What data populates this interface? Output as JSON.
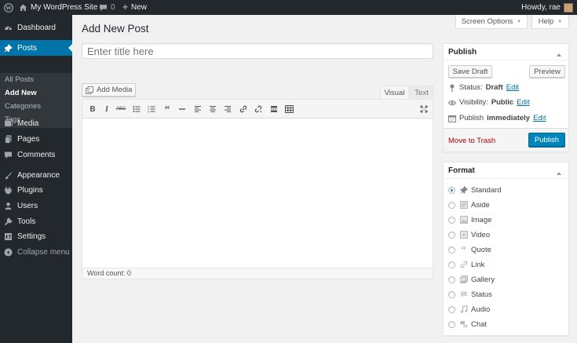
{
  "admin_bar": {
    "site_name": "My WordPress Site",
    "comments_count": "0",
    "new_label": "New",
    "greeting": "Howdy, rae"
  },
  "sidebar": {
    "items": [
      {
        "label": "Dashboard",
        "icon": "dashboard-icon"
      },
      {
        "label": "Posts",
        "icon": "pin-icon",
        "current": true
      },
      {
        "label": "Media",
        "icon": "media-icon"
      },
      {
        "label": "Pages",
        "icon": "pages-icon"
      },
      {
        "label": "Comments",
        "icon": "comment-icon"
      },
      {
        "label": "Appearance",
        "icon": "brush-icon"
      },
      {
        "label": "Plugins",
        "icon": "plugin-icon"
      },
      {
        "label": "Users",
        "icon": "user-icon"
      },
      {
        "label": "Tools",
        "icon": "wrench-icon"
      },
      {
        "label": "Settings",
        "icon": "settings-icon"
      },
      {
        "label": "Collapse menu",
        "icon": "collapse-icon"
      }
    ],
    "submenu": [
      {
        "label": "All Posts"
      },
      {
        "label": "Add New",
        "current": true
      },
      {
        "label": "Categories"
      },
      {
        "label": "Tags"
      }
    ]
  },
  "header": {
    "screen_options": "Screen Options",
    "help": "Help",
    "page_title": "Add New Post"
  },
  "editor": {
    "title_placeholder": "Enter title here",
    "title_value": "",
    "add_media": "Add Media",
    "tab_visual": "Visual",
    "tab_text": "Text",
    "word_count": "Word count: 0",
    "toolbar_buttons": [
      "bold",
      "italic",
      "strikethrough",
      "bulleted-list",
      "numbered-list",
      "blockquote",
      "horizontal-line",
      "align-left",
      "align-center",
      "align-right",
      "insert-link",
      "remove-link",
      "read-more",
      "toolbar-toggle",
      "fullscreen"
    ]
  },
  "publish": {
    "title": "Publish",
    "save_draft": "Save Draft",
    "preview": "Preview",
    "status_label": "Status:",
    "status_value": "Draft",
    "visibility_label": "Visibility:",
    "visibility_value": "Public",
    "schedule_label": "Publish",
    "schedule_value": "immediately",
    "edit_label": "Edit",
    "trash": "Move to Trash",
    "publish_button": "Publish"
  },
  "format": {
    "title": "Format",
    "options": [
      {
        "label": "Standard",
        "icon": "pin-icon",
        "checked": true
      },
      {
        "label": "Aside",
        "icon": "aside-icon"
      },
      {
        "label": "Image",
        "icon": "image-icon"
      },
      {
        "label": "Video",
        "icon": "video-icon"
      },
      {
        "label": "Quote",
        "icon": "quote-icon"
      },
      {
        "label": "Link",
        "icon": "link-icon"
      },
      {
        "label": "Gallery",
        "icon": "gallery-icon"
      },
      {
        "label": "Status",
        "icon": "status-icon"
      },
      {
        "label": "Audio",
        "icon": "audio-icon"
      },
      {
        "label": "Chat",
        "icon": "chat-icon"
      }
    ]
  },
  "colors": {
    "admin_dark": "#23282d",
    "accent_blue": "#0073aa",
    "primary_button": "#0085ba",
    "trash_red": "#a00"
  }
}
